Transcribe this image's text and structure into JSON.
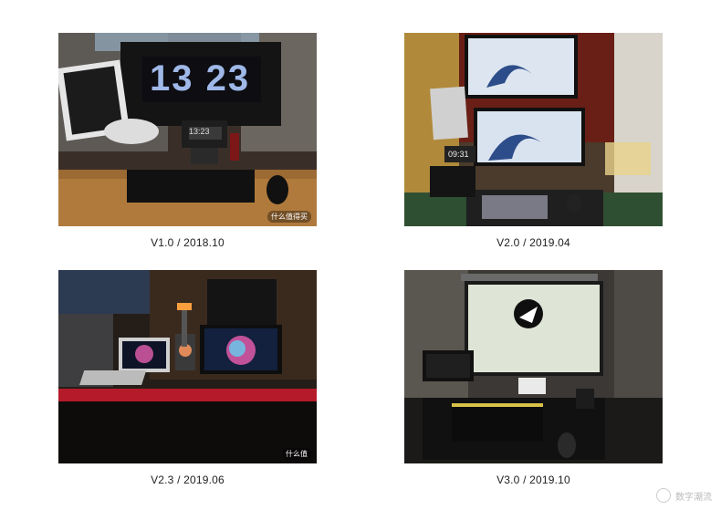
{
  "tiles": [
    {
      "caption": "V1.0 / 2018.10",
      "clock": "13 23",
      "small_clock": "13:23",
      "watermark": "什么值得买"
    },
    {
      "caption": "V2.0 / 2019.04",
      "small_clock": "09:31"
    },
    {
      "caption": "V2.3 / 2019.06",
      "watermark": "什么值"
    },
    {
      "caption": "V3.0 / 2019.10"
    }
  ],
  "corner_mark": "数字潮流"
}
